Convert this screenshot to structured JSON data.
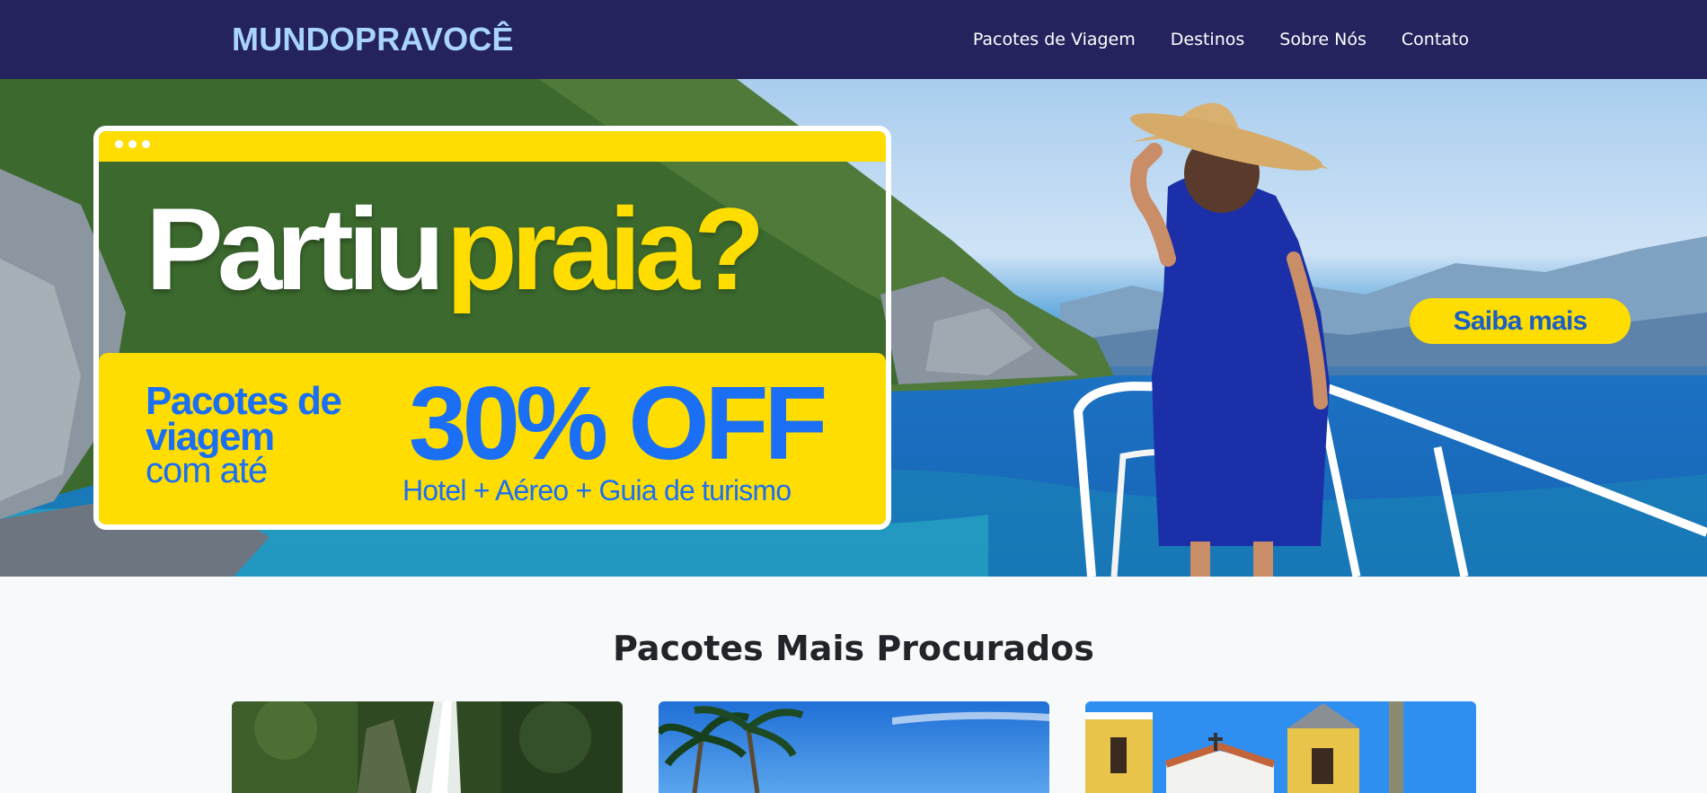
{
  "navbar": {
    "brand": "MUNDOPRAVOCÊ",
    "links": [
      "Pacotes de Viagem",
      "Destinos",
      "Sobre Nós",
      "Contato"
    ]
  },
  "hero": {
    "headline_word_1": "Partiu",
    "headline_word_2": "praia?",
    "package_line_1": "Pacotes de",
    "package_line_2": "viagem",
    "package_line_3": "com até",
    "discount": "30% OFF",
    "discount_subtitle": "Hotel + Aéreo + Guia  de turismo",
    "cta_label": "Saiba mais",
    "colors": {
      "accent_yellow": "#ffdd00",
      "accent_blue": "#1a6ff5",
      "navbar": "#25235e",
      "brand": "#a8d4ff"
    }
  },
  "section": {
    "title": "Pacotes Mais Procurados",
    "cards": [
      {
        "image": "waterfall-forest-image"
      },
      {
        "image": "palm-trees-beach-image"
      },
      {
        "image": "colonial-church-image"
      }
    ]
  }
}
